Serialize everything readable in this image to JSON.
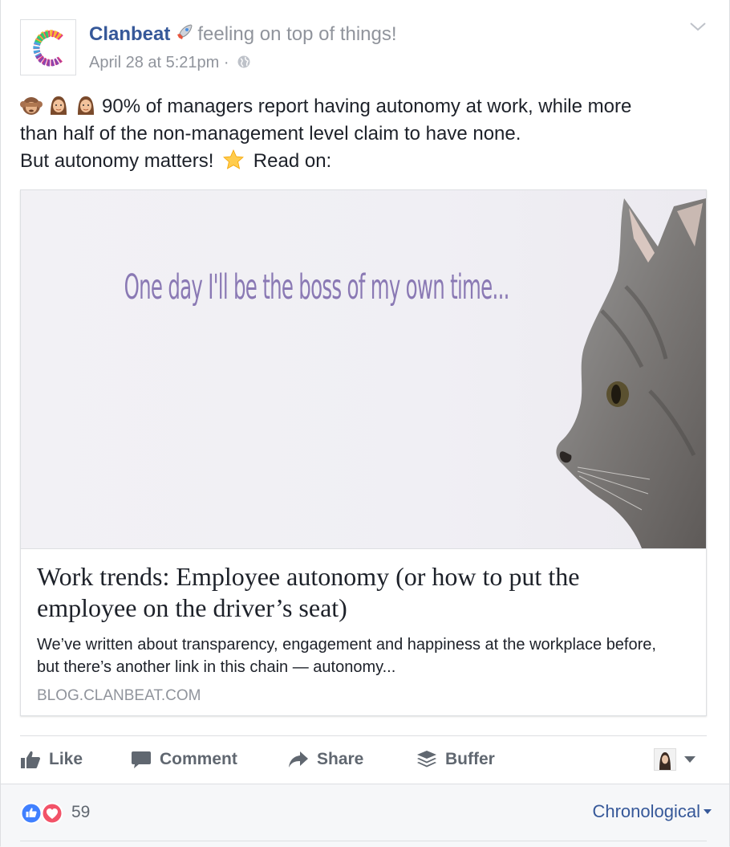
{
  "post": {
    "page_name": "Clanbeat",
    "feeling": "feeling on top of things!",
    "timestamp": "April 28 at 5:21pm",
    "separator": "·",
    "privacy_icon": "globe-icon",
    "text_line1": "90% of managers report having autonomy at work, while more",
    "text_line2": "than half of the non-management level claim to have none.",
    "text_line3a": "But autonomy matters!",
    "text_line3b": "Read on:",
    "emojis": [
      "see-no-evil-monkey",
      "person-gesturing",
      "person-gesturing"
    ]
  },
  "link": {
    "image_text": "One day I'll be the boss of my own time...",
    "title": "Work trends: Employee autonomy (or how to put the employee on the driver’s seat)",
    "description": "We’ve written about transparency, engagement and happiness at the workplace before, but there’s another link in this chain — autonomy...",
    "domain": "BLOG.CLANBEAT.COM"
  },
  "actions": {
    "like": "Like",
    "comment": "Comment",
    "share": "Share",
    "buffer": "Buffer"
  },
  "footer": {
    "reaction_count": "59",
    "sort_label": "Chronological"
  },
  "colors": {
    "link_blue": "#365899",
    "meta_gray": "#90949c",
    "action_gray": "#606770",
    "like_blue": "#4080ff",
    "love_red": "#f25268",
    "image_text_purple": "#8a79b4"
  }
}
